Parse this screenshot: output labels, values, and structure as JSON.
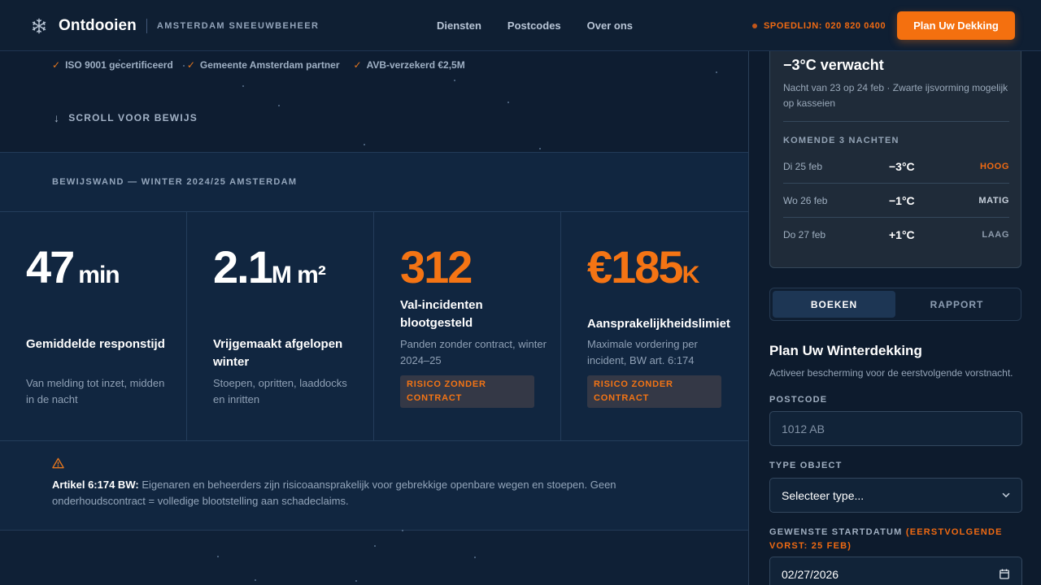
{
  "nav": {
    "brand_name": "Ontdooien",
    "brand_tag": "AMSTERDAM SNEEUWBEHEER",
    "links": [
      "Diensten",
      "Postcodes",
      "Over ons"
    ],
    "hotline": "SPOEDLIJN: 020 820 0400",
    "cta": "Plan Uw Dekking"
  },
  "hero": {
    "checks": [
      "ISO 9001 gecertificeerd",
      "Gemeente Amsterdam partner",
      "AVB-verzekerd €2,5M"
    ],
    "scroll_hint": "SCROLL VOOR BEWIJS"
  },
  "evidence": {
    "title": "BEWIJSWAND — WINTER 2024/25 AMSTERDAM",
    "stats": [
      {
        "big": "47",
        "unit": "min",
        "label": "Gemiddelde responstijd",
        "desc": "Van melding tot inzet, midden in de nacht"
      },
      {
        "big": "2.1",
        "unit": "M m²",
        "label": "Vrijgemaakt afgelopen winter",
        "desc": "Stoepen, opritten, laaddocks en inritten"
      },
      {
        "big": "312",
        "unit": "",
        "label": "Val-incidenten blootgesteld",
        "desc": "Panden zonder contract, winter 2024–25",
        "risk": "RISICO ZONDER CONTRACT"
      },
      {
        "big": "€185",
        "unit": "K",
        "label": "Aansprakelijkheidslimiet",
        "desc": "Maximale vordering per incident, BW art. 6:174",
        "risk": "RISICO ZONDER CONTRACT"
      }
    ],
    "law_bold": "Artikel 6:174 BW:",
    "law_text": "Eigenaren en beheerders zijn risicoaansprakelijk voor gebrekkige openbare wegen en stoepen. Geen onderhoudscontract = volledige blootstelling aan schadeclaims."
  },
  "weather": {
    "temp": "−3°C verwacht",
    "note": "Nacht van 23 op 24 feb · Zwarte ijsvorming mogelijk op kasseien",
    "sub": "KOMENDE 3 NACHTEN",
    "nights": [
      {
        "day": "Di 25 feb",
        "temp": "−3°C",
        "level": "HOOG",
        "color": "#f06a12"
      },
      {
        "day": "Wo 26 feb",
        "temp": "−1°C",
        "level": "MATIG",
        "color": "#c9d2dd"
      },
      {
        "day": "Do 27 feb",
        "temp": "+1°C",
        "level": "LAAG",
        "color": "#8e9cad"
      }
    ]
  },
  "tabs": {
    "active": "BOEKEN",
    "inactive": "RAPPORT"
  },
  "form": {
    "title": "Plan Uw Winterdekking",
    "subtitle": "Activeer bescherming voor de eerstvolgende vorstnacht.",
    "postcode_label": "POSTCODE",
    "postcode_placeholder": "1012 AB",
    "type_label": "TYPE OBJECT",
    "type_value": "Selecteer type...",
    "date_label": "GEWENSTE STARTDATUM",
    "date_highlight": "(EERSTVOLGENDE VORST: 25 FEB)",
    "date_value": "02/27/2026"
  },
  "colors": {
    "accent": "#f4700f",
    "background": "#0f2035"
  }
}
